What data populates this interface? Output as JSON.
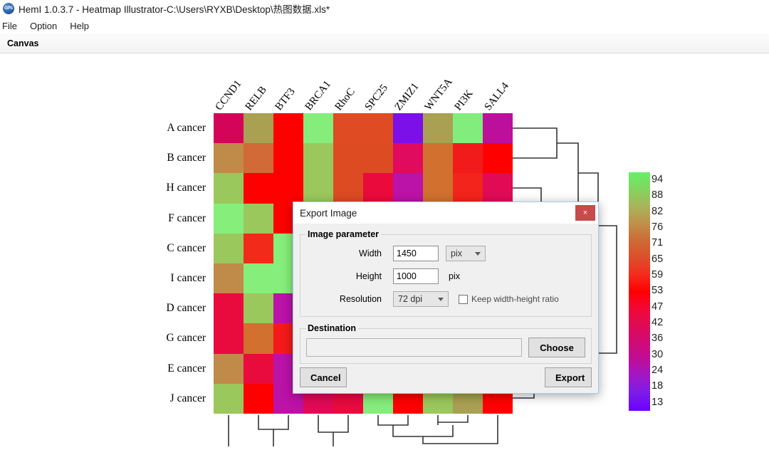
{
  "window": {
    "app_icon": "gps-app-icon",
    "title": "HemI 1.0.3.7 - Heatmap Illustrator-C:\\Users\\RYXB\\Desktop\\热图数据.xls*"
  },
  "menubar": {
    "items": [
      {
        "label": "File"
      },
      {
        "label": "Option"
      },
      {
        "label": "Help"
      }
    ]
  },
  "tabstrip": {
    "label": "Canvas"
  },
  "chart_data": {
    "type": "heatmap",
    "title": "",
    "xlabel": "",
    "ylabel": "",
    "categories": [
      "CCND1",
      "RELB",
      "BTF3",
      "BRCA1",
      "RhoC",
      "SPC25",
      "ZMIZ1",
      "WNT5A",
      "PI3K",
      "SALL4"
    ],
    "rows": [
      "A cancer",
      "B cancer",
      "H cancer",
      "F cancer",
      "C cancer",
      "I cancer",
      "D cancer",
      "G cancer",
      "E cancer",
      "J cancer"
    ],
    "colorscale_ticks": [
      94,
      88,
      82,
      76,
      71,
      65,
      59,
      53,
      47,
      42,
      36,
      30,
      24,
      18,
      13
    ],
    "colorscale_colors": [
      "#66f068",
      "#83d45f",
      "#a9b45a",
      "#bf9049",
      "#cd6a36",
      "#db4f2a",
      "#f52b1e",
      "#ff0000",
      "#f20836",
      "#e00a55",
      "#cf0b76",
      "#bf0d98",
      "#9f18c8",
      "#7b1bea",
      "#6a00ff"
    ],
    "cell_colors": [
      [
        "#d40559",
        "#a9a052",
        "#ff0000",
        "#85ed7c",
        "#df4b22",
        "#df4b22",
        "#7b10e8",
        "#a9a052",
        "#82ec7d",
        "#bb0f9c"
      ],
      [
        "#c08a48",
        "#d16a36",
        "#ff0000",
        "#9bc85d",
        "#dd4b23",
        "#dd4b23",
        "#e00a5e",
        "#d1702f",
        "#f21b1b",
        "#ff0000"
      ],
      [
        "#9bc85d",
        "#ff0000",
        "#ff0000",
        "#9bc85d",
        "#dd4b23",
        "#ea0a3c",
        "#bb12a7",
        "#d1702f",
        "#f2241b",
        "#e00a55"
      ],
      [
        "#86ee7b",
        "#9bc85d",
        "#ff0000",
        "#85ed7c",
        "#dd4b23",
        "#ea0a3c",
        "#bb12a7",
        "#d1702f",
        "#f2241b",
        "#e00a55"
      ],
      [
        "#9bc85d",
        "#f22a1a",
        "#86ee7b",
        "#9bc85d",
        "#dd4b23",
        "#ea0a3c",
        "#bb12a7",
        "#d1702f",
        "#f2241b",
        "#e00a55"
      ],
      [
        "#c08a48",
        "#86ee7b",
        "#86ee7b",
        "#9bc85d",
        "#dd4b23",
        "#ea0a3c",
        "#bb12a7",
        "#d1702f",
        "#f2241b",
        "#e00a55"
      ],
      [
        "#e90a3e",
        "#9bc85d",
        "#bb12a7",
        "#9bc85d",
        "#dd4b23",
        "#ea0a3c",
        "#bb12a7",
        "#d1702f",
        "#f2241b",
        "#e00a55"
      ],
      [
        "#e90a3e",
        "#d1702f",
        "#f51a1a",
        "#9bc85d",
        "#dd4b23",
        "#ea0a3c",
        "#bb12a7",
        "#d1702f",
        "#f2241b",
        "#e00a55"
      ],
      [
        "#c08a48",
        "#e90a3e",
        "#bb12a7",
        "#9bc85d",
        "#dd4b23",
        "#ea0a3c",
        "#bb12a7",
        "#d1702f",
        "#f2241b",
        "#e00a55"
      ],
      [
        "#9bc85d",
        "#ff0000",
        "#bb12a7",
        "#e00a55",
        "#e90a3e",
        "#85ed7c",
        "#ff0000",
        "#9bc85d",
        "#a9a052",
        "#ff0000"
      ]
    ],
    "row_dendrogram": true,
    "col_dendrogram": true
  },
  "dialog": {
    "title": "Export Image",
    "close_label": "×",
    "image_parameter": {
      "legend": "Image parameter",
      "width_label": "Width",
      "width_value": "1450",
      "width_unit_selected": "pix",
      "height_label": "Height",
      "height_value": "1000",
      "height_unit": "pix",
      "resolution_label": "Resolution",
      "resolution_selected": "72 dpi",
      "keep_ratio_label": "Keep width-height ratio",
      "keep_ratio_checked": false
    },
    "destination": {
      "legend": "Destination",
      "path_value": "",
      "path_placeholder": "",
      "choose_label": "Choose"
    },
    "cancel_label": "Cancel",
    "export_label": "Export"
  }
}
